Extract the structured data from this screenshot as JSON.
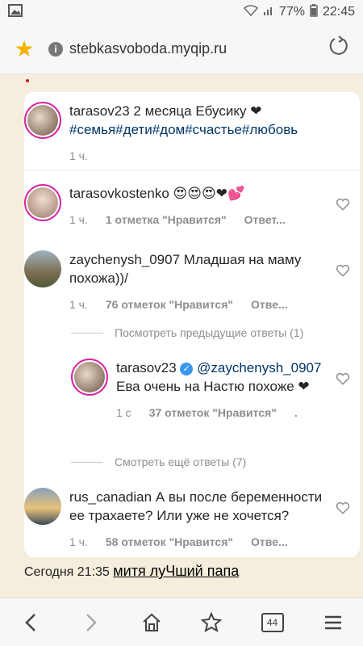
{
  "status": {
    "signal": "77%",
    "time": "22:45"
  },
  "browser": {
    "url": "stebkasvoboda.myqip.ru",
    "tabs_count": "44"
  },
  "post": {
    "caption_user": "tarasov23",
    "caption_text": "2 месяца Ебусику ❤",
    "hashtags": "#семья#дети#дом#счастье#любовь",
    "time": "1 ч."
  },
  "comments": [
    {
      "user": "tarasovkostenko",
      "text": "😍😍😍❤💕",
      "time": "1 ч.",
      "likes": "1 отметка \"Нравится\"",
      "reply": "Ответ..."
    },
    {
      "user": "zaychenysh_0907",
      "text": "Младшая на маму похожа))/",
      "time": "1 ч.",
      "likes": "76 отметок \"Нравится\"",
      "reply": "Отве..."
    }
  ],
  "view_previous": "Посмотреть предыдущие ответы (1)",
  "reply": {
    "user": "tarasov23",
    "mention": "@zaychenysh_0907",
    "text": "Ева очень на Настю похоже ❤",
    "time": "1 с",
    "likes": "37 отметок \"Нравится\"",
    "reply": "."
  },
  "view_more": "Смотреть ещё ответы (7)",
  "last_comment": {
    "user": "rus_canadian",
    "text": "А вы после беременности ее трахаете? Или уже не хочется?",
    "time": "1 ч.",
    "likes": "58 отметок \"Нравится\"",
    "reply": "Отве..."
  },
  "footer": {
    "date": "Сегодня 21:35",
    "link": "митя луЧший папа"
  }
}
